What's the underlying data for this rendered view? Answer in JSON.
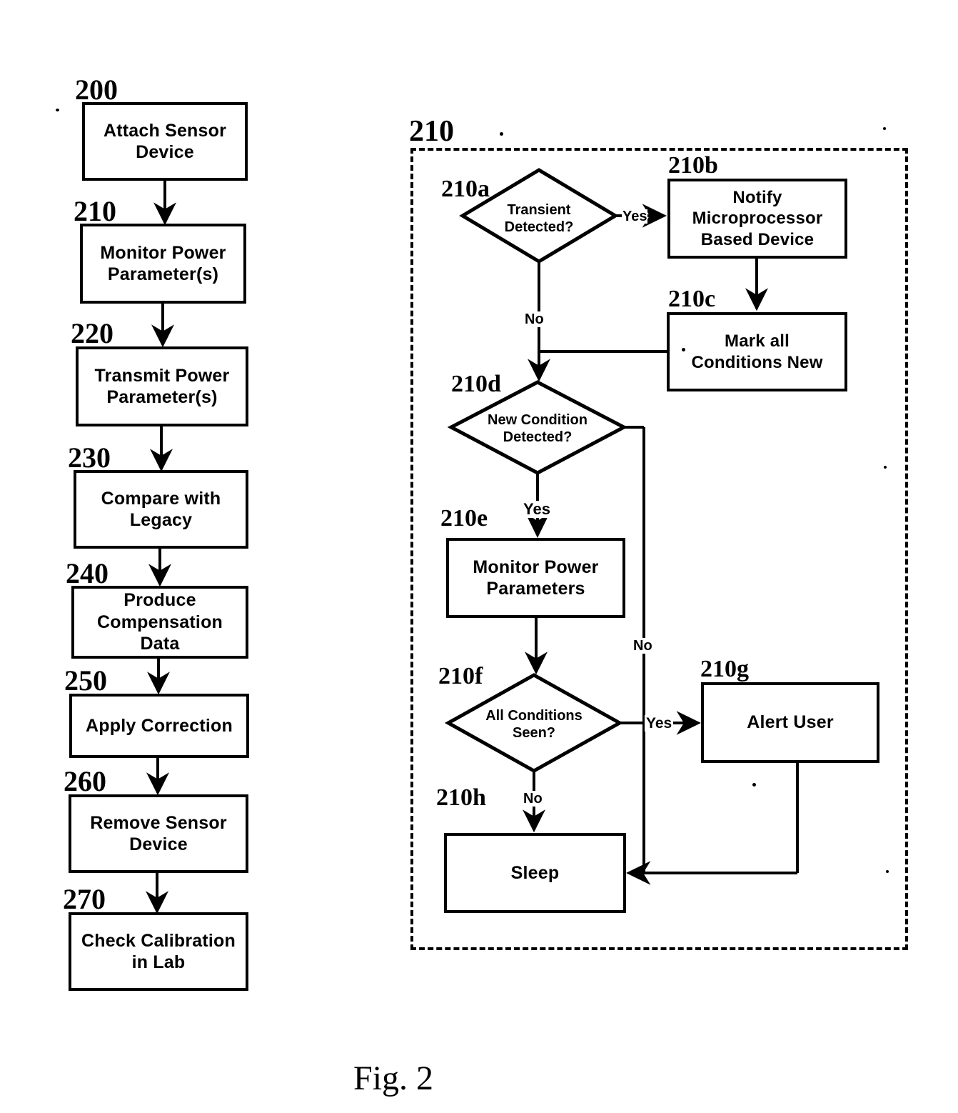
{
  "figure": {
    "caption": "Fig. 2",
    "title_number": "200"
  },
  "left_flow": {
    "name": "calibration-process-flow",
    "steps": [
      {
        "ref": "200",
        "label": "Attach Sensor\nDevice"
      },
      {
        "ref": "210",
        "label": "Monitor Power\nParameter(s)"
      },
      {
        "ref": "220",
        "label": "Transmit Power\nParameter(s)"
      },
      {
        "ref": "230",
        "label": "Compare with\nLegacy"
      },
      {
        "ref": "240",
        "label": "Produce\nCompensation\nData"
      },
      {
        "ref": "250",
        "label": "Apply Correction"
      },
      {
        "ref": "260",
        "label": "Remove Sensor\nDevice"
      },
      {
        "ref": "270",
        "label": "Check Calibration\nin Lab"
      }
    ]
  },
  "right_flow": {
    "name": "monitor-power-parameters-detail",
    "group_ref": "210",
    "nodes": [
      {
        "ref": "210a",
        "type": "decision",
        "label": "Transient\nDetected?"
      },
      {
        "ref": "210b",
        "type": "process",
        "label": "Notify\nMicroprocessor\nBased Device"
      },
      {
        "ref": "210c",
        "type": "process",
        "label": "Mark all\nConditions New"
      },
      {
        "ref": "210d",
        "type": "decision",
        "label": "New Condition\nDetected?"
      },
      {
        "ref": "210e",
        "type": "process",
        "label": "Monitor Power\nParameters"
      },
      {
        "ref": "210f",
        "type": "decision",
        "label": "All Conditions\nSeen?"
      },
      {
        "ref": "210g",
        "type": "process",
        "label": "Alert User"
      },
      {
        "ref": "210h",
        "type": "process",
        "label": "Sleep"
      }
    ],
    "edge_labels": {
      "a_yes": "Yes",
      "a_no": "No",
      "d_yes": "Yes",
      "d_no": "No",
      "f_yes": "Yes",
      "f_no": "No"
    }
  },
  "colors": {
    "ink": "#000000",
    "paper": "#ffffff"
  }
}
